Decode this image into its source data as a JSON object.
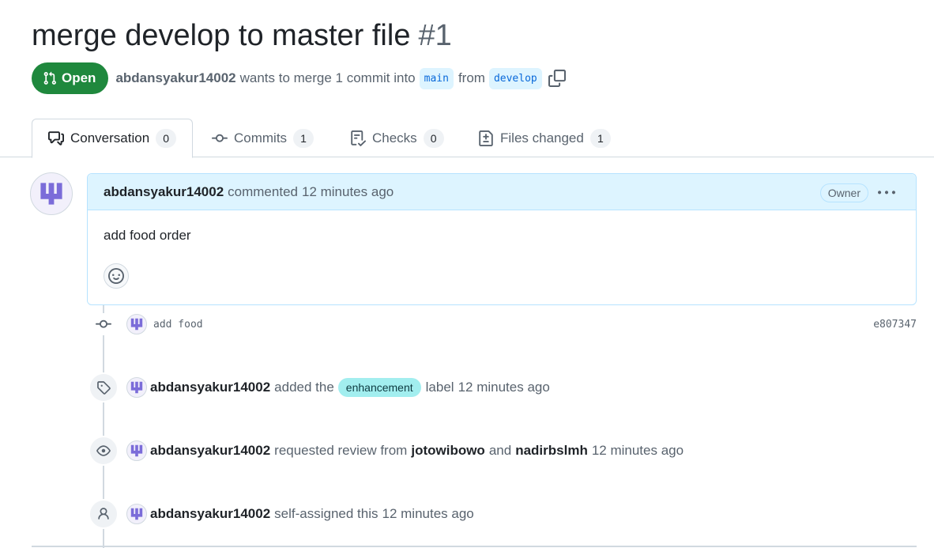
{
  "pr": {
    "title": "merge develop to master file",
    "number": "#1",
    "state": "Open",
    "author": "abdansyakur14002",
    "merge_text": "wants to merge 1 commit into",
    "base_branch": "main",
    "from_text": "from",
    "head_branch": "develop"
  },
  "tabs": [
    {
      "label": "Conversation",
      "count": "0",
      "icon": "comment-discussion-icon"
    },
    {
      "label": "Commits",
      "count": "1",
      "icon": "git-commit-icon"
    },
    {
      "label": "Checks",
      "count": "0",
      "icon": "checklist-icon"
    },
    {
      "label": "Files changed",
      "count": "1",
      "icon": "file-diff-icon"
    }
  ],
  "comment": {
    "author": "abdansyakur14002",
    "action": "commented",
    "time": "12 minutes ago",
    "role": "Owner",
    "body": "add food order"
  },
  "commit": {
    "message": "add food",
    "sha": "e807347"
  },
  "events": [
    {
      "author": "abdansyakur14002",
      "pre": "added the",
      "label": "enhancement",
      "post": "label",
      "time": "12 minutes ago",
      "icon": "tag-icon"
    },
    {
      "author": "abdansyakur14002",
      "pre": "requested review from",
      "reviewer1": "jotowibowo",
      "and": "and",
      "reviewer2": "nadirbslmh",
      "time": "12 minutes ago",
      "icon": "eye-icon"
    },
    {
      "author": "abdansyakur14002",
      "pre": "self-assigned this",
      "time": "12 minutes ago",
      "icon": "person-icon"
    }
  ],
  "colors": {
    "open_green": "#1f883d",
    "link_blue": "#0969da",
    "branch_bg": "#ddf4ff",
    "label_bg": "#a2eeef",
    "avatar_purple": "#7b6cd9"
  }
}
